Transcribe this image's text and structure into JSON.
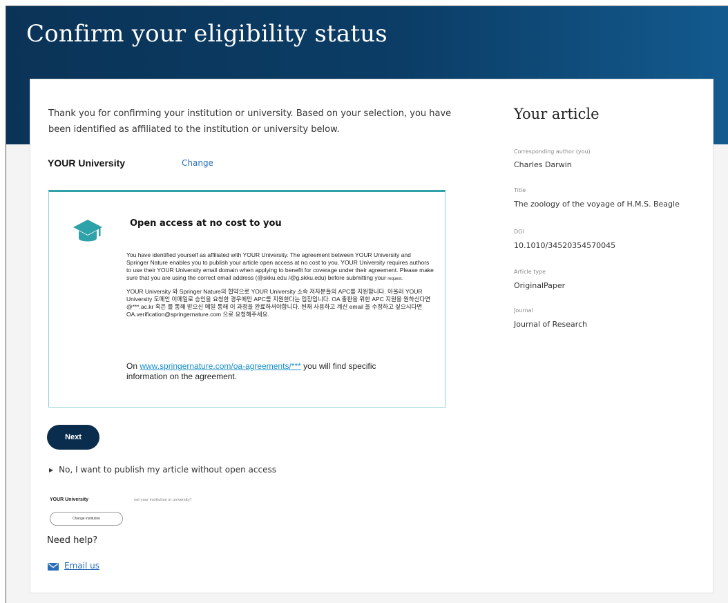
{
  "header": {
    "title": "Confirm your eligibility status"
  },
  "intro": {
    "text": "Thank you for confirming your institution or university. Based on your selection, you have been identified as affiliated to the institution or university below."
  },
  "institution": {
    "name": "YOUR University",
    "change_label": "Change"
  },
  "oa_box": {
    "icon": "graduation-cap-icon",
    "title": "Open access at no cost to you",
    "paragraph_en": "You have identified yourself as affiliated with YOUR University. The agreement between YOUR University and Springer Nature enables you to publish your article open access at  no cost to you. YOUR University requires authors to use their YOUR University email domain when applying to benefit for coverage under their agreement. Please make sure that you are using the correct email address (@skku.edu /@g.skku.edu)  before submitting your",
    "paragraph_en_tail": "request.",
    "paragraph_ko": "YOUR University 와 Springer Nature의 협약으로 YOUR University 소속 저자분들의 APC를 지원합니다. 아울러 YOUR University 도메인 이메일로 승인을 요청한 경우에만 APC를 지원한다는 입장입니다. OA 출판을 위한 APC 지원을 원하신다면 @***.ac.kr 혹은 를 통해 받으신 메일 통해 이 과정을 완료하셔야합니다. 현재 사용하고 계신 email 을 수정하고 싶으시다면 OA.verification@springernature.com 으로 요청해주세요.",
    "link_prefix": "On ",
    "link_text": "www.springernature.com/oa-agreements/***",
    "link_suffix": "you will find specific information on the agreement."
  },
  "actions": {
    "next_label": "Next",
    "no_oa_label": "No, I want to publish my article without open access"
  },
  "institution_small": {
    "name": "YOUR University",
    "not_yours": "not your institution or university?",
    "change_button": "Change institution"
  },
  "help": {
    "title": "Need help?",
    "email_label": "Email us"
  },
  "sidebar": {
    "title": "Your article",
    "author_label": "Corresponding author (you)",
    "author": "Charles Darwin",
    "title_label": "Title",
    "article_title": "The zoology of the voyage of H.M.S. Beagle",
    "doi_label": "DOI",
    "doi": "10.1010/34520354570045",
    "type_label": "Article type",
    "type": "OriginalPaper",
    "journal_label": "Journal",
    "journal": "Journal of Research"
  },
  "colors": {
    "header": "#0b3357",
    "accent": "#2ea2a8",
    "button": "#0b2d4d",
    "link": "#2a6ebb"
  }
}
